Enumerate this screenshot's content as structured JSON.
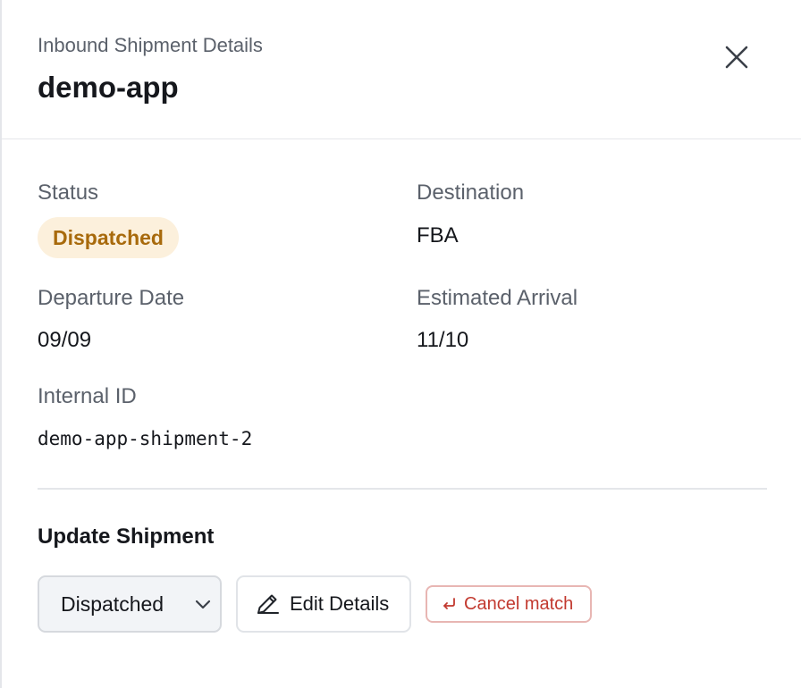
{
  "header": {
    "subtitle": "Inbound Shipment Details",
    "title": "demo-app",
    "close_icon": "close-icon"
  },
  "fields": {
    "status": {
      "label": "Status",
      "value": "Dispatched"
    },
    "destination": {
      "label": "Destination",
      "value": "FBA"
    },
    "departure": {
      "label": "Departure Date",
      "value": "09/09"
    },
    "arrival": {
      "label": "Estimated Arrival",
      "value": "11/10"
    },
    "internal_id": {
      "label": "Internal ID",
      "value": "demo-app-shipment-2"
    }
  },
  "update": {
    "title": "Update Shipment",
    "status_select": {
      "selected": "Dispatched",
      "icon": "chevron-down-icon"
    },
    "edit_button": {
      "label": "Edit Details",
      "icon": "pencil-icon"
    },
    "cancel_button": {
      "label": "Cancel match",
      "icon": "undo-arrow-icon"
    }
  },
  "colors": {
    "badge_bg": "#fcf0dc",
    "badge_text": "#a86a0c",
    "cancel_text": "#c2392f",
    "cancel_border": "#e8b6b3",
    "muted_text": "#5b616b"
  }
}
